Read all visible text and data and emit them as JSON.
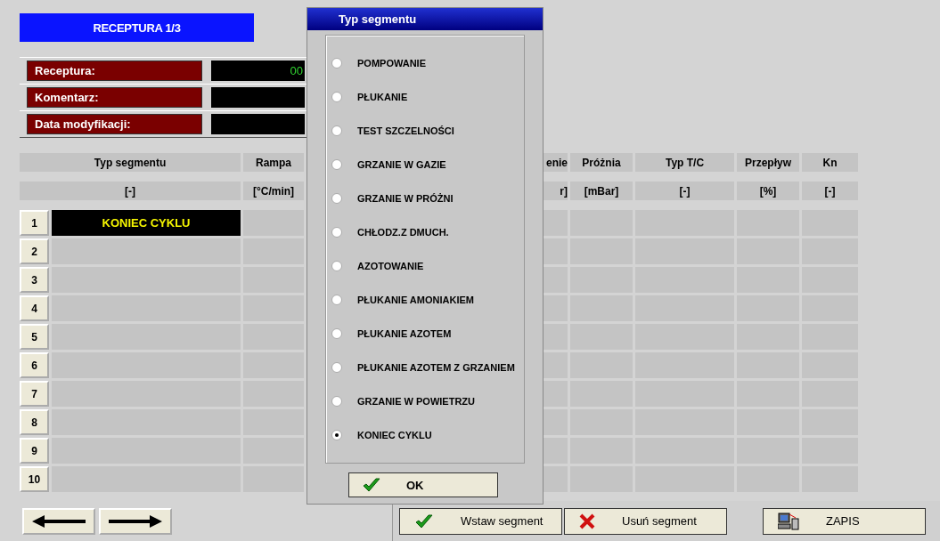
{
  "header": {
    "title": "RECEPTURA 1/3"
  },
  "fields": [
    {
      "label": "Receptura:",
      "value": "00"
    },
    {
      "label": "Komentarz:"
    },
    {
      "label": "Data modyfikacji:"
    }
  ],
  "table": {
    "columns": [
      {
        "name": "Typ segmentu",
        "unit": "[-]"
      },
      {
        "name": "Rampa",
        "unit": "[°C/min]"
      },
      {
        "name": "enie",
        "unit": "r]"
      },
      {
        "name": "Próżnia",
        "unit": "[mBar]"
      },
      {
        "name": "Typ T/C",
        "unit": "[-]"
      },
      {
        "name": "Przepływ",
        "unit": "[%]"
      },
      {
        "name": "Kn",
        "unit": "[-]"
      }
    ],
    "rows": [
      {
        "number": "1",
        "segment": "KONIEC CYKLU"
      },
      {
        "number": "2"
      },
      {
        "number": "3"
      },
      {
        "number": "4"
      },
      {
        "number": "5"
      },
      {
        "number": "6"
      },
      {
        "number": "7"
      },
      {
        "number": "8"
      },
      {
        "number": "9"
      },
      {
        "number": "10"
      }
    ]
  },
  "buttons": [
    {
      "kind": "insert",
      "label": "Wstaw segment"
    },
    {
      "kind": "delete",
      "label": "Usuń segment"
    },
    {
      "kind": "save",
      "label": "ZAPIS"
    }
  ],
  "dialog": {
    "title": "Typ segmentu",
    "options": [
      {
        "label": "POMPOWANIE",
        "selected": false
      },
      {
        "label": "PŁUKANIE",
        "selected": false
      },
      {
        "label": "TEST SZCZELNOŚCI",
        "selected": false
      },
      {
        "label": "GRZANIE W GAZIE",
        "selected": false
      },
      {
        "label": "GRZANIE W PRÓŻNI",
        "selected": false
      },
      {
        "label": "CHŁODZ.Z DMUCH.",
        "selected": false
      },
      {
        "label": "AZOTOWANIE",
        "selected": false
      },
      {
        "label": "PŁUKANIE AMONIAKIEM",
        "selected": false
      },
      {
        "label": "PŁUKANIE AZOTEM",
        "selected": false
      },
      {
        "label": "PŁUKANIE AZOTEM Z GRZANIEM",
        "selected": false
      },
      {
        "label": "GRZANIE W POWIETRZU",
        "selected": false
      },
      {
        "label": "KONIEC CYKLU",
        "selected": true
      }
    ],
    "ok_button": "OK"
  }
}
